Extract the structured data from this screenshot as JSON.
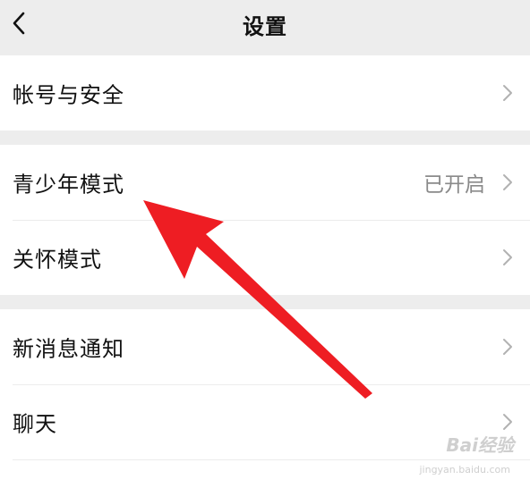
{
  "nav": {
    "title": "设置",
    "back_icon": "chevron-left-icon"
  },
  "groups": [
    {
      "items": [
        {
          "label": "帐号与安全",
          "value": ""
        }
      ]
    },
    {
      "items": [
        {
          "label": "青少年模式",
          "value": "已开启"
        },
        {
          "label": "关怀模式",
          "value": ""
        }
      ]
    },
    {
      "items": [
        {
          "label": "新消息通知",
          "value": ""
        },
        {
          "label": "聊天",
          "value": ""
        }
      ]
    }
  ],
  "annotation": {
    "arrow_color": "#ee1d23",
    "target": "青少年模式"
  },
  "watermark": {
    "logo": "Bai经验",
    "url": "jingyan.baidu.com"
  },
  "colors": {
    "background": "#ededed",
    "card": "#ffffff",
    "text": "#111111",
    "secondary_text": "#8a8a8a",
    "chevron": "#b2b2b2"
  }
}
